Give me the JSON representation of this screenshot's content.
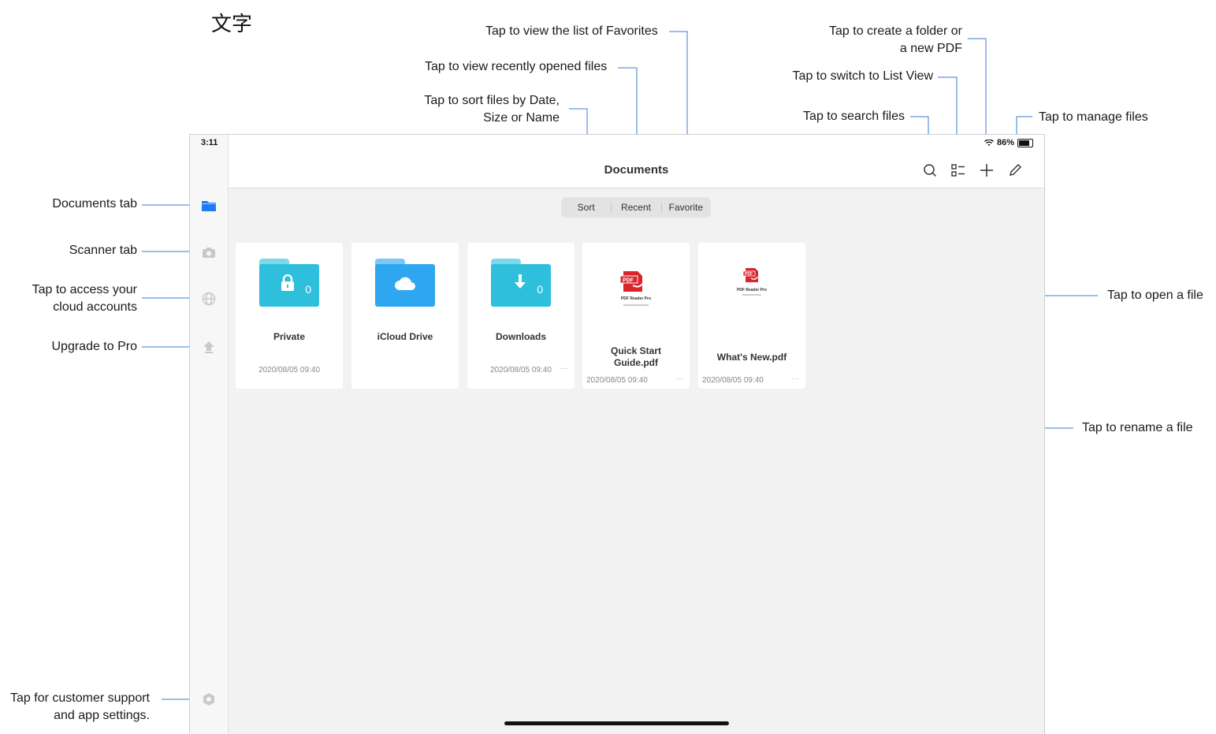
{
  "page_heading": "文字",
  "annotations": {
    "favorites": "Tap to view the list of Favorites",
    "recent": "Tap to view recently opened files",
    "sort_line1": "Tap to sort files by Date,",
    "sort_line2": "Size or Name",
    "create_line1": "Tap to create a folder or",
    "create_line2": "a new PDF",
    "list_view": "Tap to switch to List View",
    "search": "Tap to search files",
    "manage": "Tap to manage files",
    "documents_tab": "Documents tab",
    "scanner_tab": "Scanner tab",
    "cloud_line1": "Tap to access your",
    "cloud_line2": "cloud accounts",
    "upgrade": "Upgrade to Pro",
    "open_file": "Tap to open a file",
    "rename_file": "Tap to rename a file",
    "support_line1": "Tap for customer support",
    "support_line2": "and app settings."
  },
  "status_bar": {
    "time": "3:11",
    "battery": "86%"
  },
  "header": {
    "title": "Documents"
  },
  "toolbar_icons": [
    "search-icon",
    "list-view-icon",
    "plus-icon",
    "pencil-icon"
  ],
  "segments": [
    "Sort",
    "Recent",
    "Favorite"
  ],
  "sidebar_icons": [
    "folder-icon",
    "camera-icon",
    "globe-icon",
    "upgrade-arrow-icon",
    "settings-gear-icon"
  ],
  "files": [
    {
      "name": "Private",
      "date": "2020/08/05 09:40",
      "kind": "folder",
      "icon": "lock-icon",
      "count": "0"
    },
    {
      "name": "iCloud Drive",
      "date": "",
      "kind": "folder",
      "icon": "cloud-icon",
      "count": ""
    },
    {
      "name": "Downloads",
      "date": "2020/08/05 09:40",
      "kind": "folder",
      "icon": "download-arrow-icon",
      "count": "0"
    },
    {
      "name": "Quick Start Guide.pdf",
      "name_line1": "Quick Start",
      "name_line2": "Guide.pdf",
      "date": "2020/08/05 09:40",
      "kind": "pdf",
      "thumb_caption": "PDF Reader Pro"
    },
    {
      "name": "What's New.pdf",
      "date": "2020/08/05 09:40",
      "kind": "pdf",
      "thumb_caption": "PDF Reader Pro"
    }
  ],
  "colors": {
    "accent": "#1e7cf2",
    "folder": "#2ebfdd",
    "cloud_folder": "#2ea7f0",
    "callout_line": "#3a7bd5",
    "pdf_red": "#d9252c"
  }
}
